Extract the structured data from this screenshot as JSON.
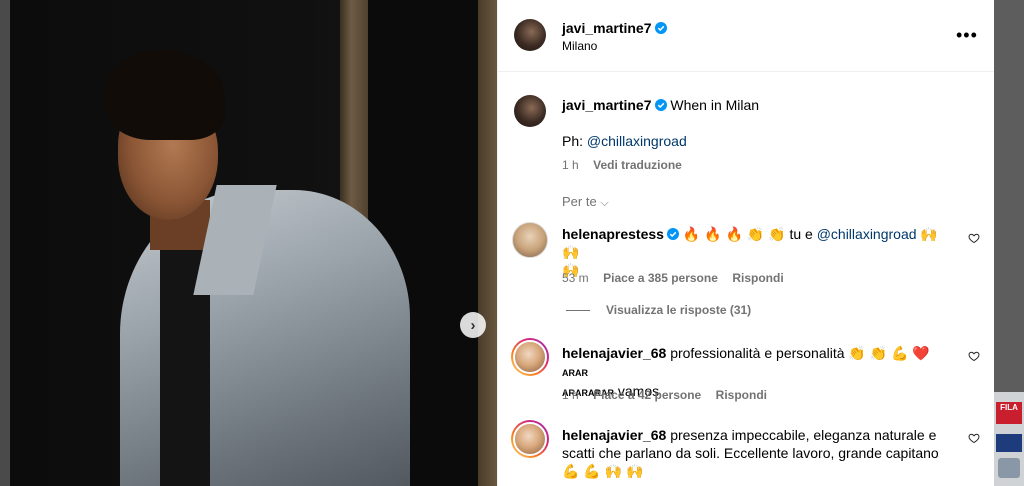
{
  "post": {
    "author": "javi_martine7",
    "location": "Milano",
    "more_icon": "ellipsis-icon",
    "caption_text": "When in Milan",
    "caption_credit_prefix": "Ph:",
    "caption_credit_handle": "@chillaxingroad",
    "caption_time": "1 h",
    "translate_label": "Vedi traduzione",
    "next_icon": "chevron-right-icon"
  },
  "sort": {
    "label": "Per te"
  },
  "comments": [
    {
      "user": "helenaprestess",
      "text_before": "🔥 🔥 🔥 👏 👏 tu e",
      "mention": "@chillaxingroad",
      "text_after": "🙌 🙌",
      "text_line2": "🙌",
      "time": "53 m",
      "likes": "Piace a 385 persone",
      "reply": "Rispondi",
      "view_replies": "Visualizza le risposte (31)"
    },
    {
      "user": "helenajavier_68",
      "text_line1": "professionalità e personalità 👏 👏 💪 ❤️",
      "small_caps_1": "ARAR",
      "small_caps_2": "ARARARAR",
      "text_line2_tail": "vamos",
      "time": "1 h",
      "likes": "Piace a 42 persone",
      "reply": "Rispondi"
    },
    {
      "user": "helenajavier_68",
      "text_line1": "presenza impeccabile, eleganza naturale e",
      "text_line2": "scatti che parlano da soli. Eccellente lavoro, grande capitano",
      "text_line3": "💪 💪 🙌 🙌"
    }
  ],
  "background": {
    "thumb_brand": "FILA"
  },
  "colors": {
    "verified": "#0095f6",
    "link": "#00376b",
    "muted": "#737373"
  }
}
